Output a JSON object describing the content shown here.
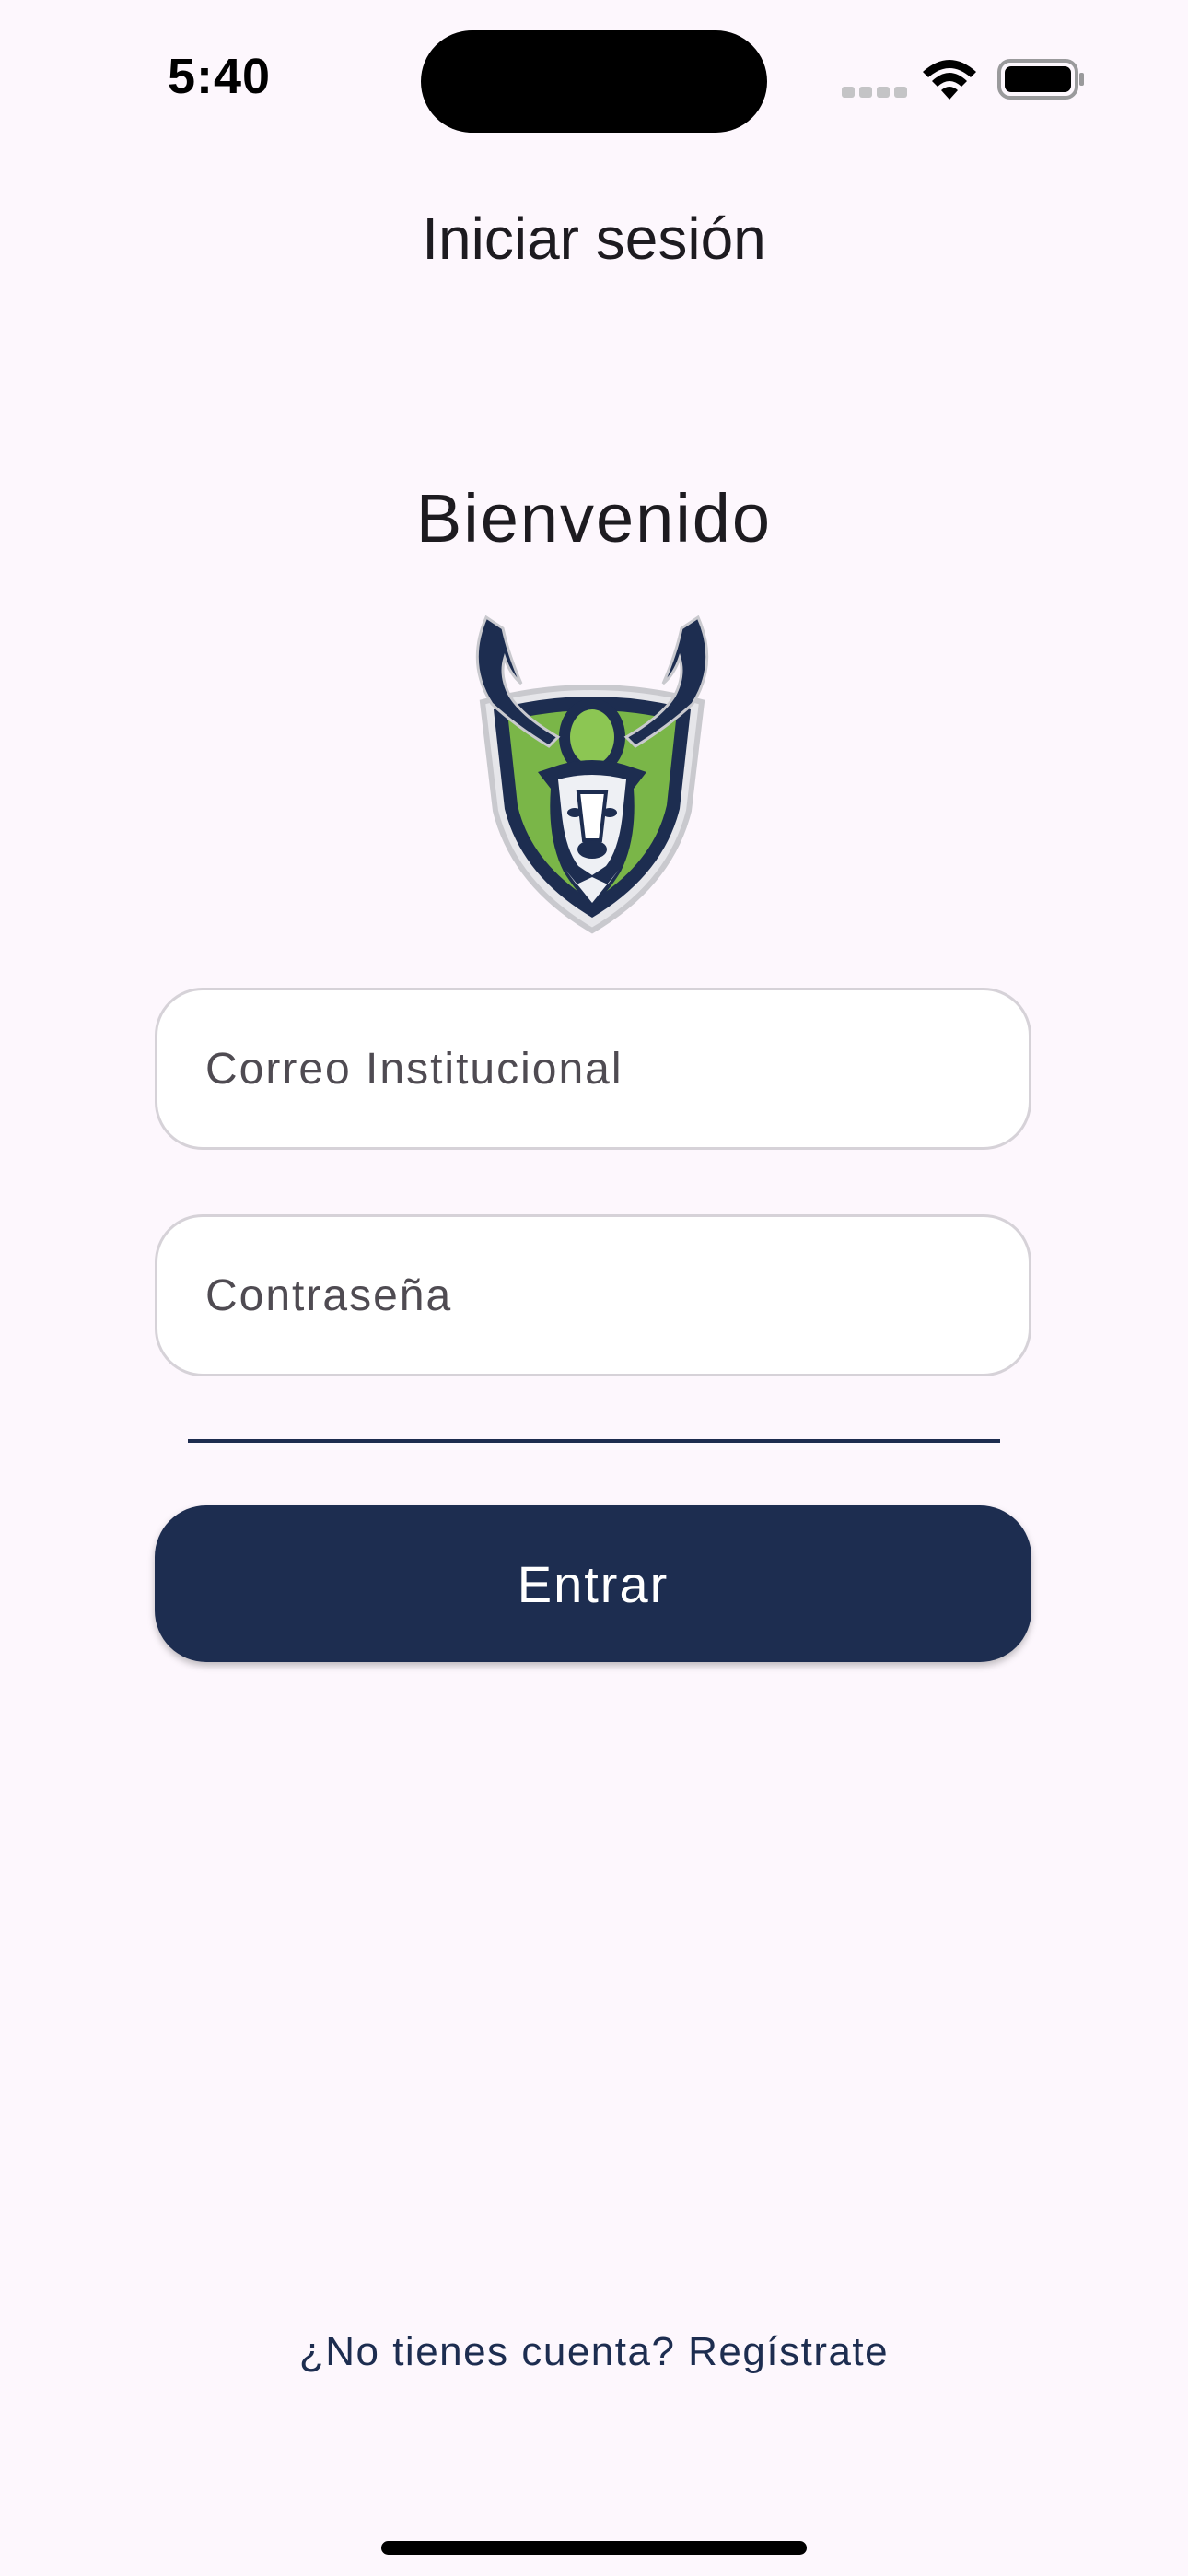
{
  "status_bar": {
    "time": "5:40",
    "icons": [
      "signal-icon",
      "wifi-icon",
      "battery-icon"
    ]
  },
  "header": {
    "title": "Iniciar sesión"
  },
  "main": {
    "welcome": "Bienvenido",
    "logo": {
      "icon": "deer-shield-logo",
      "colors": {
        "primary": "#1d2d50",
        "accent": "#7ab648"
      }
    },
    "email": {
      "placeholder": "Correo Institucional",
      "value": ""
    },
    "password": {
      "placeholder": "Contraseña",
      "value": ""
    },
    "login_button": "Entrar",
    "register_link": "¿No tienes cuenta? Regístrate"
  },
  "colors": {
    "background": "#fdf7fd",
    "primary": "#1d2d50",
    "field_border": "#d6d2d8"
  }
}
